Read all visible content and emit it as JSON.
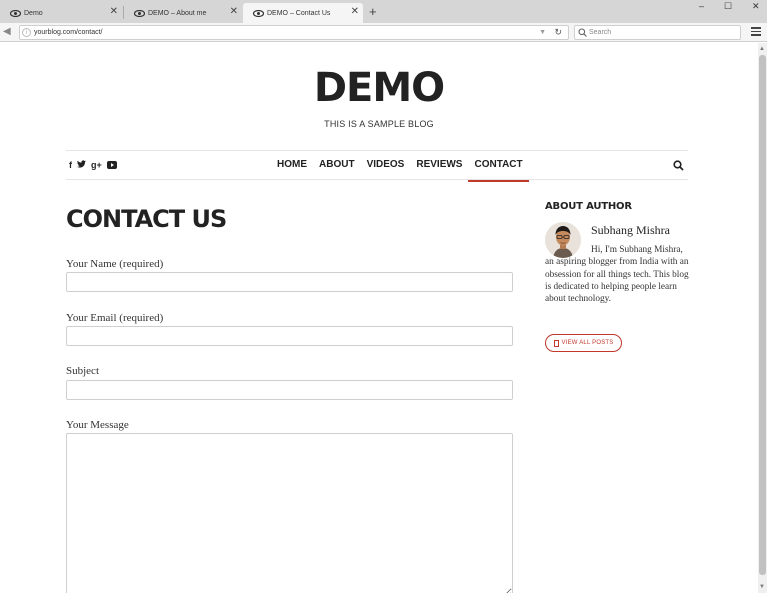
{
  "browser": {
    "tabs": [
      {
        "title": "Demo",
        "active": false
      },
      {
        "title": "DEMO – About me",
        "active": false
      },
      {
        "title": "DEMO – Contact Us",
        "active": true
      }
    ],
    "new_tab": "+",
    "window_controls": {
      "minimize": "–",
      "maximize": "☐",
      "close": "✕"
    },
    "url": "yourblog.com/contact/",
    "search_placeholder": "Search",
    "icons": [
      "eye-icon",
      "close-icon",
      "back-arrow-icon",
      "info-icon",
      "dropdown-icon",
      "reload-icon",
      "search-icon",
      "hamburger-menu-icon"
    ]
  },
  "site": {
    "title": "DEMO",
    "tagline": "THIS IS A SAMPLE BLOG"
  },
  "nav": {
    "social_icons": [
      "facebook-icon",
      "twitter-icon",
      "google-plus-icon",
      "youtube-icon"
    ],
    "social_glyphs": {
      "facebook": "f",
      "twitter": "𝕥",
      "gplus": "g+"
    },
    "items": [
      {
        "label": "HOME",
        "active": false
      },
      {
        "label": "ABOUT",
        "active": false
      },
      {
        "label": "VIDEOS",
        "active": false
      },
      {
        "label": "REVIEWS",
        "active": false
      },
      {
        "label": "CONTACT",
        "active": true
      }
    ],
    "active_color": "#c0392b"
  },
  "main": {
    "heading": "CONTACT US",
    "fields": [
      {
        "label": "Your Name (required)",
        "value": ""
      },
      {
        "label": "Your Email (required)",
        "value": ""
      },
      {
        "label": "Subject",
        "value": ""
      },
      {
        "label": "Your Message",
        "value": ""
      }
    ]
  },
  "sidebar": {
    "heading": "ABOUT AUTHOR",
    "author_name": "Subhang Mishra",
    "bio": "Hi, I'm Subhang Mishra, an aspiring blogger from India with an obsession for all things tech. This blog is dedicated to helping people learn about technology.",
    "view_all_label": "VIEW ALL POSTS"
  }
}
